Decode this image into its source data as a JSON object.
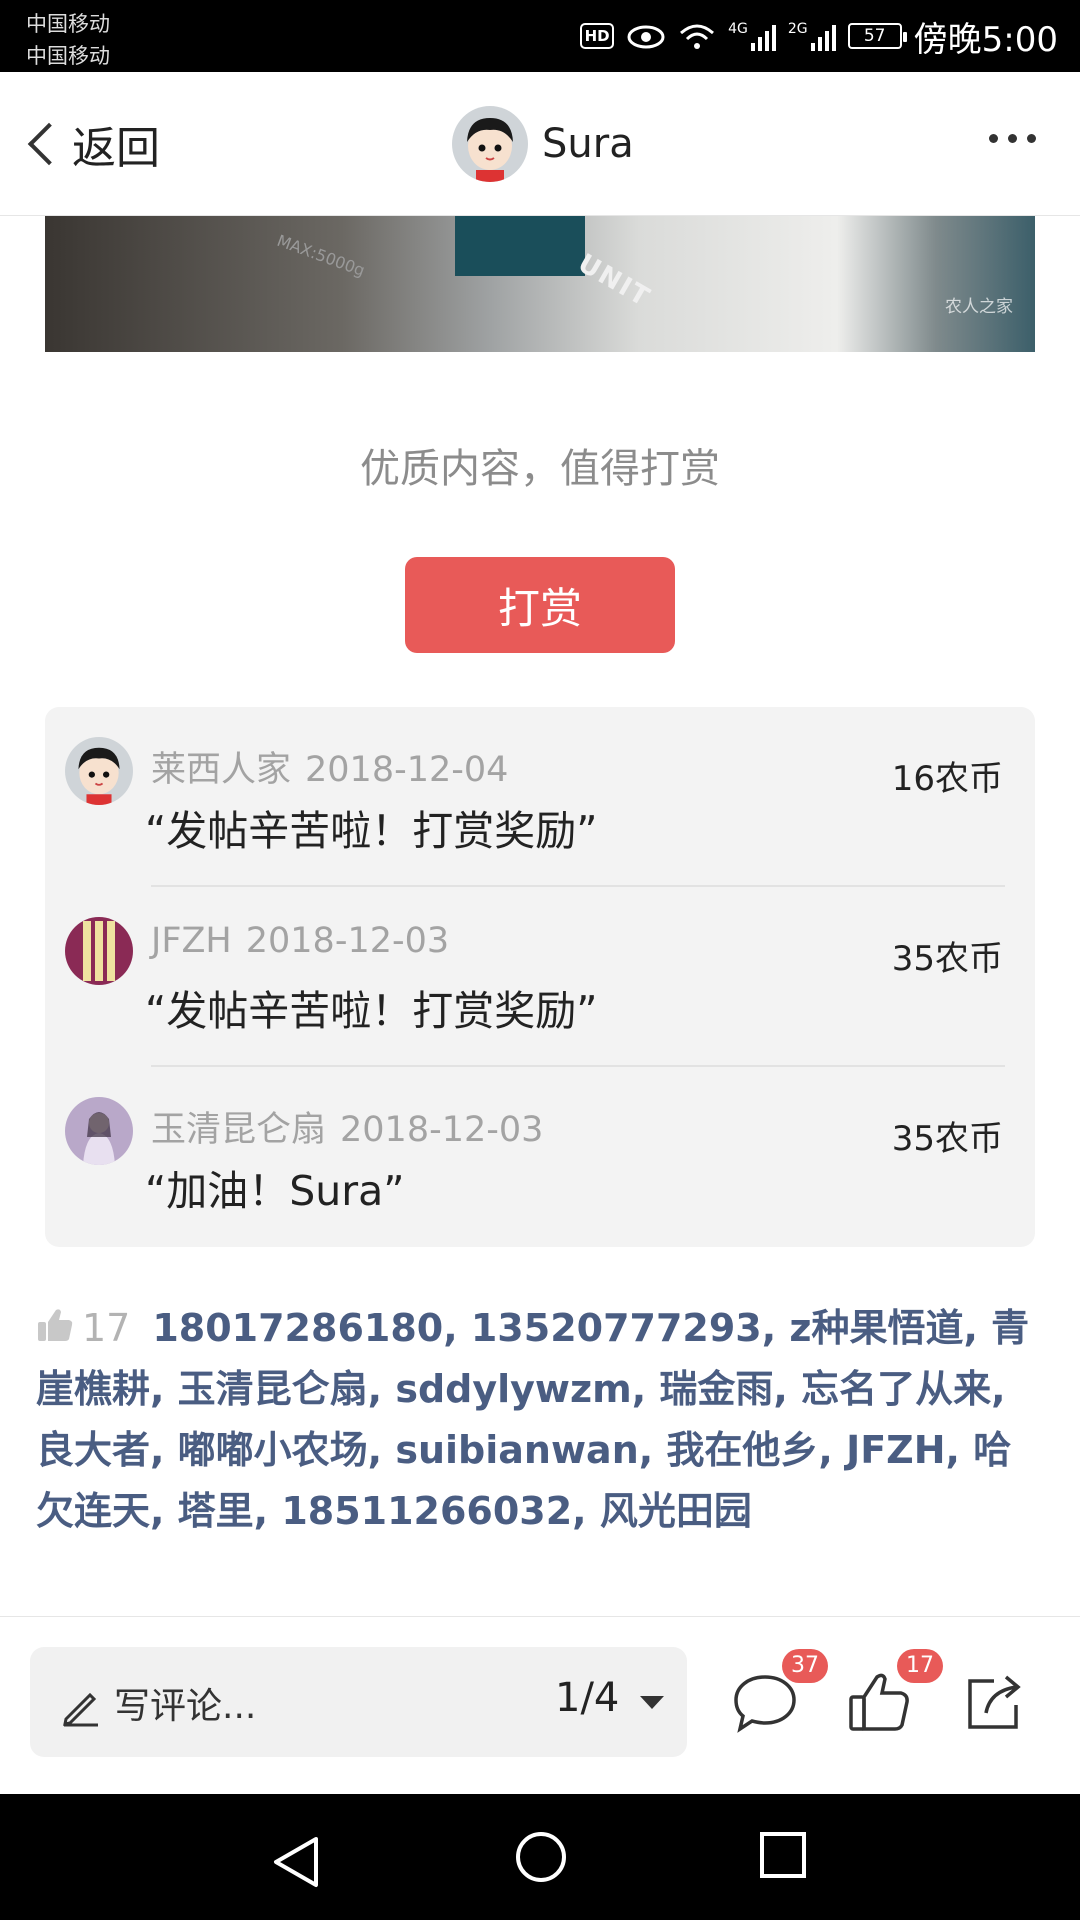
{
  "status_bar": {
    "carrier_1": "中国移动",
    "carrier_2": "中国移动",
    "hd": "HD",
    "signal_1": "4G",
    "signal_2": "2G",
    "battery": "57",
    "time": "傍晚5:00"
  },
  "nav": {
    "back_label": "返回",
    "author": "Sura"
  },
  "photo": {
    "watermark": "农人之家",
    "unit_text": "UNIT",
    "scale_text": "MAX:5000g"
  },
  "reward": {
    "tip": "优质内容，值得打赏",
    "button": "打赏",
    "items": [
      {
        "name": "莱西人家",
        "date": "2018-12-04",
        "message": "“发帖辛苦啦！打赏奖励”",
        "amount": "16农币"
      },
      {
        "name": "JFZH",
        "date": "2018-12-03",
        "message": "“发帖辛苦啦！打赏奖励”",
        "amount": "35农币"
      },
      {
        "name": "玉清昆仑扇",
        "date": "2018-12-03",
        "message": "“加油！Sura”",
        "amount": "35农币"
      }
    ]
  },
  "likes": {
    "count": "17",
    "names": "18017286180, 13520777293, z种果悟道, 青崖樵耕, 玉清昆仑扇, sddylywzm, 瑞金雨, 忘名了从来, 良大者, 嘟嘟小农场, suibianwan, 我在他乡, JFZH, 哈欠连天, 塔里, 18511266032, 风光田园"
  },
  "bottom_bar": {
    "comment_placeholder": "写评论...",
    "page_indicator": "1/4",
    "comment_count": "37",
    "like_count": "17"
  },
  "colors": {
    "accent": "#e85a58",
    "link": "#4a5d82",
    "muted": "#a3a3a3"
  }
}
